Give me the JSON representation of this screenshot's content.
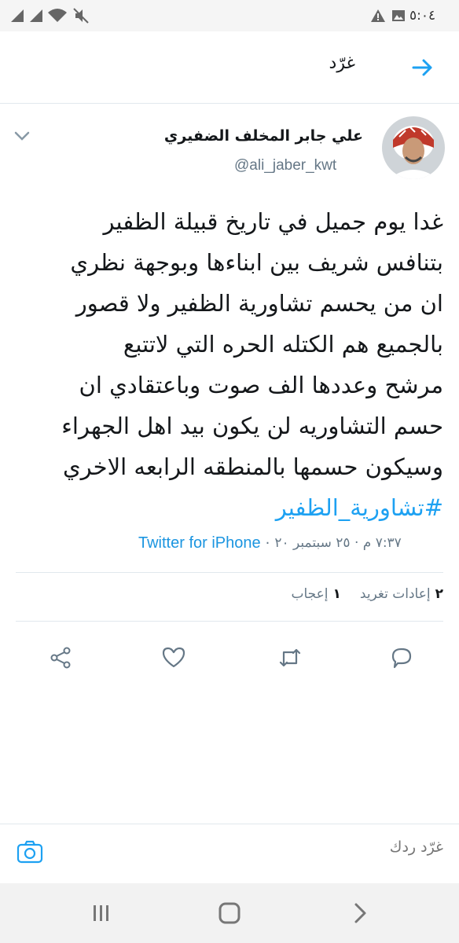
{
  "status_bar": {
    "time": "٥:٠٤",
    "icons": [
      "signal-icon",
      "signal-icon",
      "wifi-icon",
      "mute-icon",
      "warning-icon",
      "image-icon"
    ]
  },
  "header": {
    "title": "غرّد",
    "back_icon": "arrow-right-icon"
  },
  "tweet": {
    "display_name": "علي جابر المخلف الضفيري",
    "handle": "@ali_jaber_kwt",
    "lines": [
      "غدا يوم جميل في تاريخ قبيلة الظفير",
      "بتنافس شريف بين ابناءها وبوجهة نظري",
      "ان من يحسم تشاورية الظفير ولا قصور",
      "بالجميع هم الكتله الحره التي لاتتبع",
      "مرشح وعددها الف صوت وباعتقادي ان",
      "حسم التشاوريه لن يكون بيد اهل الجهراء",
      "وسيكون حسمها بالمنطقه الرابعه الاخري"
    ],
    "hashtag": "#تشاورية_الظفير",
    "timestamp": "٧:٣٧ م · ٢٥ سبتمبر ٢٠",
    "source": "Twitter for iPhone",
    "stats": {
      "retweets_count": "٢",
      "retweets_label": "إعادات تغريد",
      "likes_count": "١",
      "likes_label": "إعجاب"
    }
  },
  "actions": [
    "reply-icon",
    "retweet-icon",
    "like-icon",
    "share-icon"
  ],
  "reply_bar": {
    "placeholder": "غرّد ردك"
  },
  "nav_bar": [
    "recent-apps-icon",
    "home-icon",
    "back-icon"
  ],
  "colors": {
    "accent": "#1da1f2",
    "text_secondary": "#657786",
    "divider": "#e1e8ed"
  }
}
